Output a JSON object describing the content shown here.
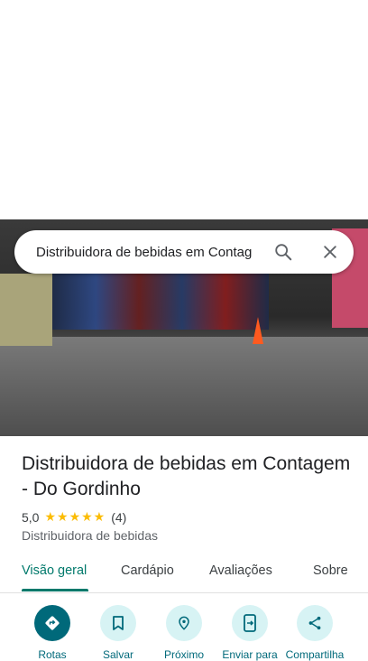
{
  "search": {
    "query": "Distribuidora de bebidas em Contag",
    "search_icon": "search-icon",
    "close_icon": "close-icon"
  },
  "place": {
    "name": "Distribuidora de bebidas em Contagem - Do Gordinho",
    "rating": "5,0",
    "stars": "★★★★★",
    "review_count": "(4)",
    "category": "Distribuidora de bebidas"
  },
  "tabs": [
    {
      "label": "Visão geral",
      "active": true
    },
    {
      "label": "Cardápio"
    },
    {
      "label": "Avaliações"
    },
    {
      "label": "Sobre"
    }
  ],
  "actions": [
    {
      "label": "Rotas",
      "icon": "directions-icon"
    },
    {
      "label": "Salvar",
      "icon": "bookmark-icon"
    },
    {
      "label": "Próximo",
      "icon": "nearby-icon"
    },
    {
      "label": "Enviar para",
      "icon": "send-to-phone-icon"
    },
    {
      "label": "Compartilha",
      "icon": "share-icon"
    }
  ],
  "colors": {
    "accent": "#00796b",
    "action_primary": "#00697a",
    "action_bg": "#d7f3f4",
    "star": "#fbbc04"
  }
}
